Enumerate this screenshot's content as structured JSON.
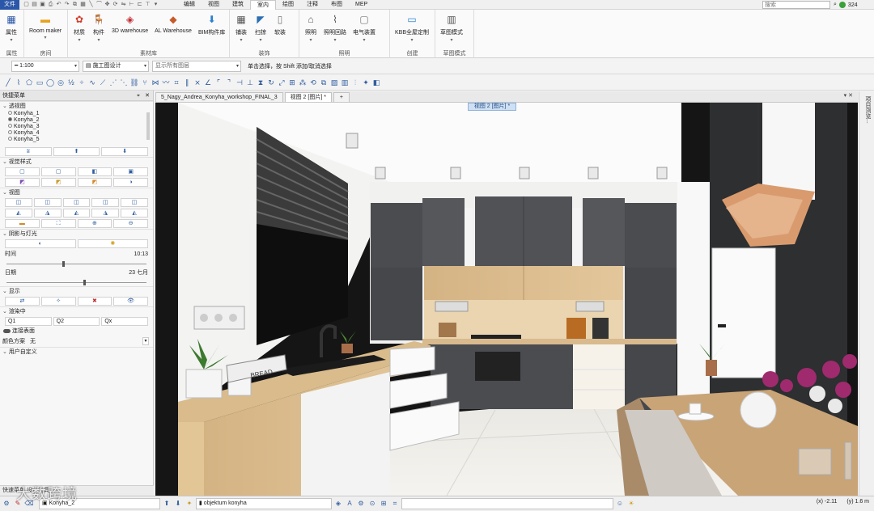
{
  "menubar": {
    "file": "文件",
    "tabs": [
      "编辑",
      "视图",
      "建筑",
      "室内",
      "绘图",
      "注释",
      "布图",
      "MEP"
    ],
    "active_tab": "室内",
    "search_placeholder": "搜索",
    "count": "324"
  },
  "ribbon": {
    "groups": [
      {
        "label": "属性",
        "buttons": [
          {
            "label": "属性",
            "icon": "properties-icon"
          }
        ]
      },
      {
        "label": "房间",
        "buttons": [
          {
            "label": "Room maker",
            "icon": "room-maker-icon"
          }
        ]
      },
      {
        "label": "素材库",
        "buttons": [
          {
            "label": "材质",
            "icon": "material-icon"
          },
          {
            "label": "构件",
            "icon": "component-icon"
          },
          {
            "label": "3D warehouse",
            "icon": "3d-warehouse-icon"
          },
          {
            "label": "AL Warehouse",
            "icon": "al-warehouse-icon"
          },
          {
            "label": "BIM构件库",
            "icon": "bim-library-icon"
          }
        ]
      },
      {
        "label": "装饰",
        "buttons": [
          {
            "label": "铺装",
            "icon": "tiling-icon"
          },
          {
            "label": "扫掠",
            "icon": "sweep-icon"
          },
          {
            "label": "软装",
            "icon": "soft-decor-icon"
          }
        ]
      },
      {
        "label": "照明",
        "buttons": [
          {
            "label": "照明",
            "icon": "lamp-icon"
          },
          {
            "label": "照明回路",
            "icon": "lighting-circuit-icon"
          },
          {
            "label": "电气装置",
            "icon": "electric-device-icon"
          }
        ]
      },
      {
        "label": "创建",
        "buttons": [
          {
            "label": "KBB全屋定制",
            "icon": "kbb-custom-icon"
          }
        ]
      },
      {
        "label": "草图模式",
        "buttons": [
          {
            "label": "草图模式",
            "icon": "sketch-mode-icon"
          }
        ]
      }
    ]
  },
  "toolbar1": {
    "scale": "1:100",
    "drawing_design": "施工图设计",
    "layers": "显示所有图层",
    "hint": "单击选择，按 Shift 添加/取消选择"
  },
  "panel": {
    "title": "快捷菜单",
    "sections": {
      "perspective": "透视图",
      "visual_style": "视觉样式",
      "view": "视图",
      "shadow_light": "阴影与灯光",
      "display": "显示",
      "render": "渲染中",
      "custom": "用户自定义"
    },
    "views": [
      "Konyha_1",
      "Konyha_2",
      "Konyha_3",
      "Konyha_4",
      "Konyha_5"
    ],
    "time_label": "时间",
    "time_value": "10:13",
    "date_label": "日期",
    "date_value": "23 七月",
    "time_fraction": 0.4,
    "date_fraction": 0.55,
    "render_buttons": [
      "Q1",
      "Q2",
      "Qx"
    ],
    "connect_surface": "连接表面",
    "color_scheme_label": "颜色方案",
    "color_scheme_value": "无",
    "footer": "快速菜单  设计工具"
  },
  "document_tabs": [
    {
      "label": "5_Nagy_Andrea_Konyha_workshop_FINAL_3",
      "active": false
    },
    {
      "label": "视图 2 [图片] *",
      "active": true
    }
  ],
  "viewport_label": "视图 2 [图片] *",
  "right_strip": "项目浏览...",
  "statusbar": {
    "view_name": "Konyha_2",
    "object_name": "objektum konyha",
    "x": "(x) -2.11",
    "y": "(y) 1.6 m"
  },
  "watermark": "大数跨境",
  "colors": {
    "accent": "#2b57a8",
    "cabinet": "#4a4c50",
    "wood": "#d9bb8c"
  }
}
